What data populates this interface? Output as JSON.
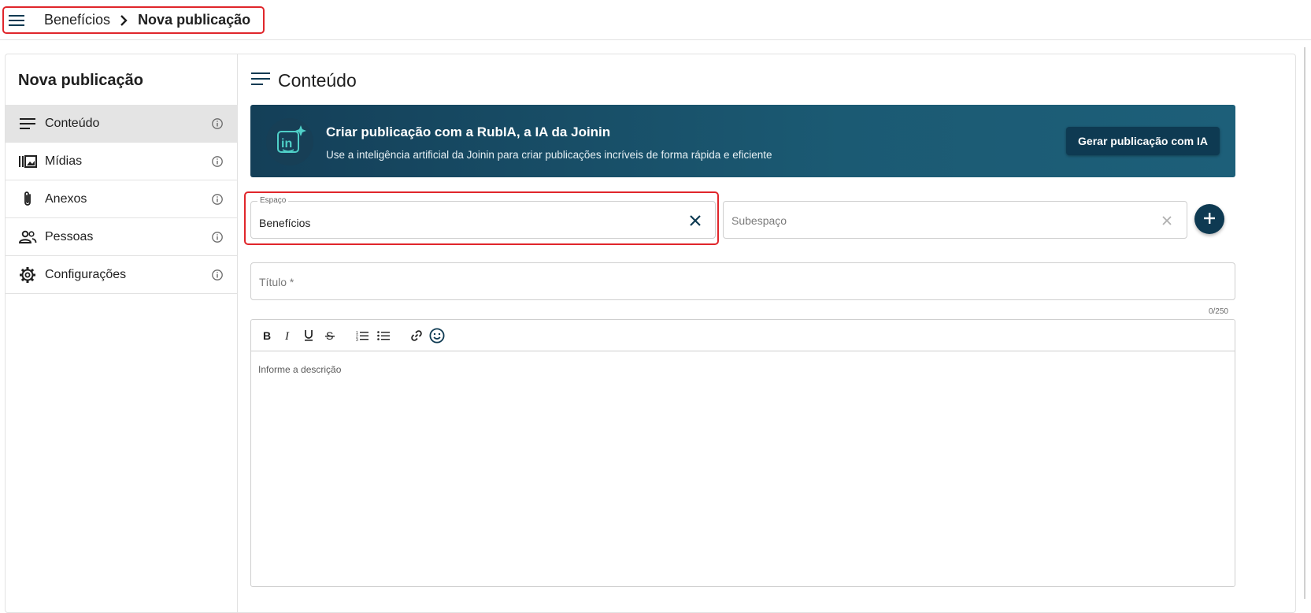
{
  "header": {
    "breadcrumb": [
      "Benefícios",
      "Nova publicação"
    ]
  },
  "sidebar": {
    "title": "Nova publicação",
    "items": [
      {
        "label": "Conteúdo",
        "icon": "lines-icon",
        "active": true
      },
      {
        "label": "Mídias",
        "icon": "media-library-icon"
      },
      {
        "label": "Anexos",
        "icon": "paperclip-icon"
      },
      {
        "label": "Pessoas",
        "icon": "people-icon"
      },
      {
        "label": "Configurações",
        "icon": "gear-icon"
      }
    ]
  },
  "main": {
    "section_title": "Conteúdo",
    "ai_banner": {
      "title": "Criar publicação com a RubIA, a IA da Joinin",
      "subtitle": "Use a inteligência artificial da Joinin para criar publicações incríveis de forma rápida e eficiente",
      "button_label": "Gerar publicação com IA"
    },
    "espaco": {
      "label": "Espaço",
      "value": "Benefícios"
    },
    "subespaco": {
      "placeholder": "Subespaço"
    },
    "titulo": {
      "placeholder": "Título *",
      "counter": "0/250"
    },
    "editor": {
      "placeholder": "Informe a descrição"
    }
  },
  "colors": {
    "accent": "#0e3a52",
    "banner": "#1b5a73",
    "highlight": "#e0262b"
  }
}
